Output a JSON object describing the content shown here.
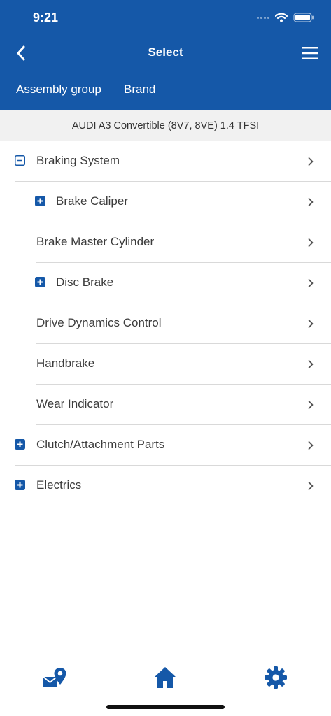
{
  "status_bar": {
    "time": "9:21"
  },
  "nav": {
    "title": "Select",
    "back_icon": "chevron-left-icon",
    "menu_icon": "hamburger-menu-icon"
  },
  "tabs": [
    {
      "label": "Assembly group"
    },
    {
      "label": "Brand"
    }
  ],
  "vehicle": "AUDI A3 Convertible (8V7, 8VE) 1.4 TFSI",
  "tree": [
    {
      "label": "Braking System",
      "level": 0,
      "toggle": "minus"
    },
    {
      "label": "Brake Caliper",
      "level": 1,
      "toggle": "plus"
    },
    {
      "label": "Brake Master Cylinder",
      "level": 1,
      "toggle": "none"
    },
    {
      "label": "Disc Brake",
      "level": 1,
      "toggle": "plus"
    },
    {
      "label": "Drive Dynamics Control",
      "level": 1,
      "toggle": "none"
    },
    {
      "label": "Handbrake",
      "level": 1,
      "toggle": "none"
    },
    {
      "label": "Wear Indicator",
      "level": 1,
      "toggle": "none"
    },
    {
      "label": "Clutch/Attachment Parts",
      "level": 0,
      "toggle": "plus"
    },
    {
      "label": "Electrics",
      "level": 0,
      "toggle": "plus"
    }
  ],
  "tab_bar": [
    {
      "icon": "mail-location-icon"
    },
    {
      "icon": "home-icon"
    },
    {
      "icon": "gear-icon"
    }
  ],
  "colors": {
    "brand": "#1558a8",
    "text": "#3c3c3c",
    "divider": "#d9d9d9",
    "vehicle_bar": "#f1f1f1"
  }
}
